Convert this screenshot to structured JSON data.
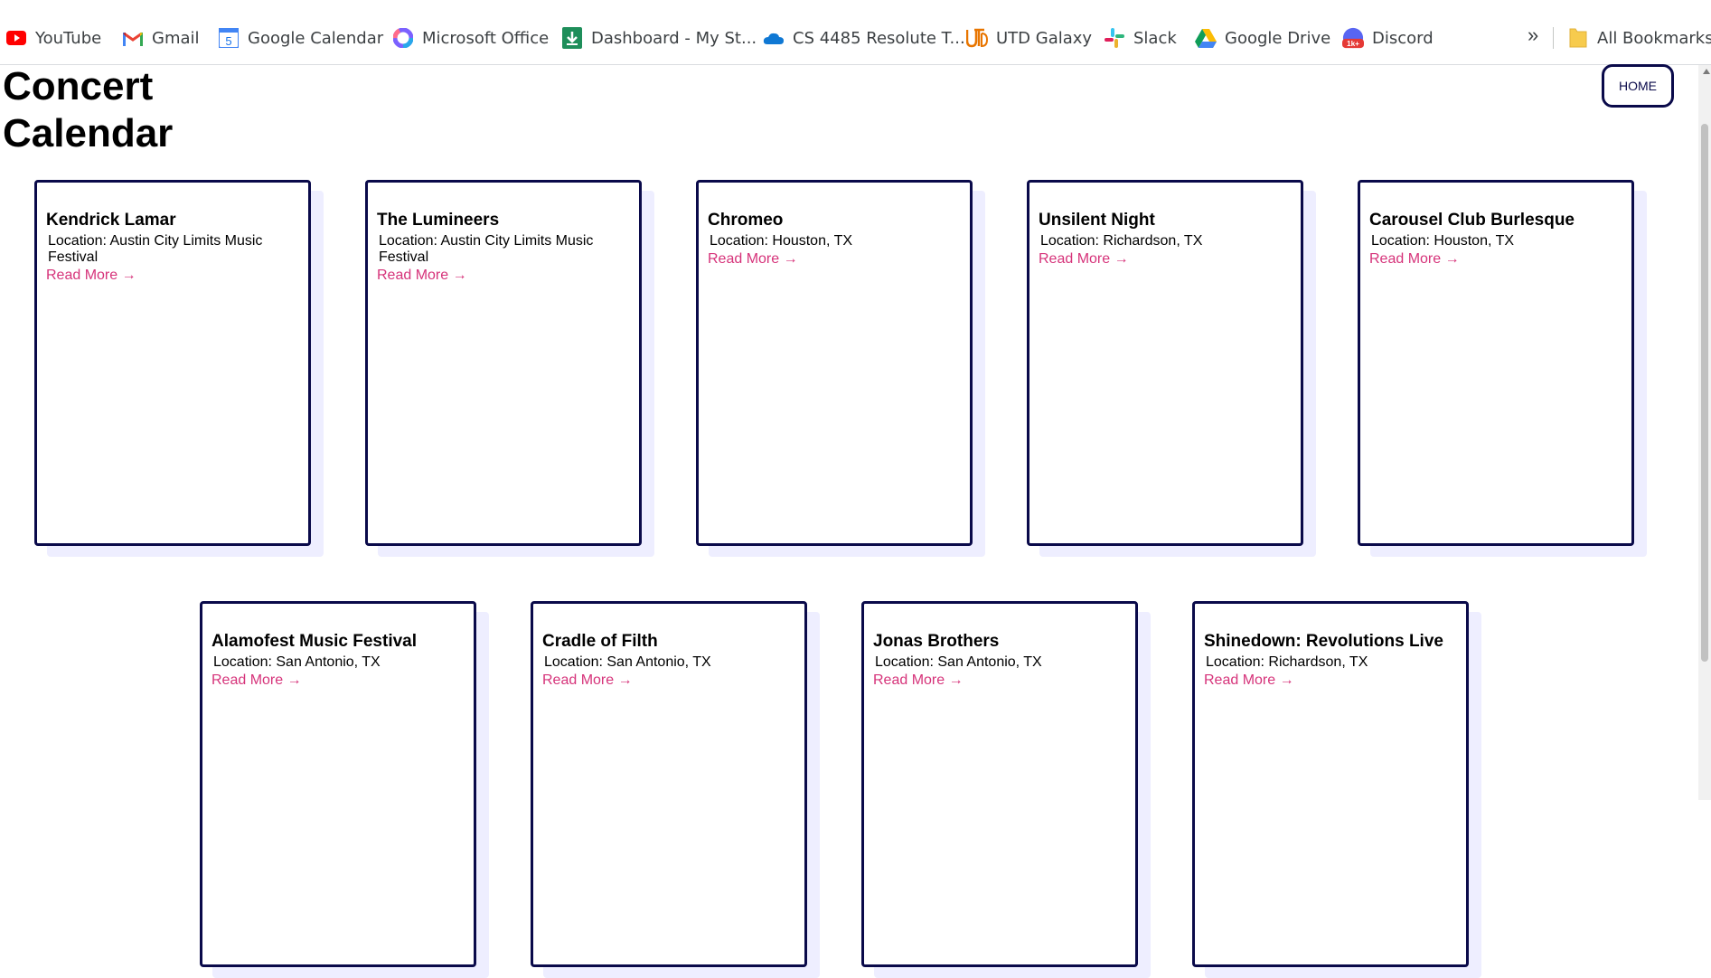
{
  "bookmarks": [
    {
      "label": "YouTube",
      "icon": "youtube-icon"
    },
    {
      "label": "Gmail",
      "icon": "gmail-icon"
    },
    {
      "label": "Google Calendar",
      "icon": "google-calendar-icon"
    },
    {
      "label": "Microsoft Office",
      "icon": "microsoft-office-icon"
    },
    {
      "label": "Dashboard - My St...",
      "icon": "dashboard-icon"
    },
    {
      "label": "CS 4485 Resolute T...",
      "icon": "onedrive-icon"
    },
    {
      "label": "UTD Galaxy",
      "icon": "utd-galaxy-icon"
    },
    {
      "label": "Slack",
      "icon": "slack-icon"
    },
    {
      "label": "Google Drive",
      "icon": "google-drive-icon"
    },
    {
      "label": "Discord",
      "icon": "discord-icon"
    }
  ],
  "bookmarks_more": "»",
  "all_bookmarks": "All Bookmarks",
  "calendar_badge": "5",
  "discord_badge": "1k+",
  "page": {
    "title": "Concert Calendar",
    "home_button": "HOME"
  },
  "cards": [
    {
      "name": "Kendrick Lamar",
      "location": "Location: Austin City Limits Music Festival",
      "link": "Read More →"
    },
    {
      "name": "The Lumineers",
      "location": "Location: Austin City Limits Music Festival",
      "link": "Read More →"
    },
    {
      "name": "Chromeo",
      "location": "Location: Houston, TX",
      "link": "Read More →"
    },
    {
      "name": "Unsilent Night",
      "location": "Location: Richardson, TX",
      "link": "Read More →"
    },
    {
      "name": "Carousel Club Burlesque",
      "location": "Location: Houston, TX",
      "link": "Read More →"
    },
    {
      "name": "Alamofest Music Festival",
      "location": "Location: San Antonio, TX",
      "link": "Read More →"
    },
    {
      "name": "Cradle of Filth",
      "location": "Location: San Antonio, TX",
      "link": "Read More →"
    },
    {
      "name": "Jonas Brothers",
      "location": "Location: San Antonio, TX",
      "link": "Read More →"
    },
    {
      "name": "Shinedown: Revolutions Live",
      "location": "Location: Richardson, TX",
      "link": "Read More →"
    }
  ],
  "colors": {
    "card_border": "#0a0a4a",
    "card_shadow": "#eeeeff",
    "link": "#d6337a"
  }
}
